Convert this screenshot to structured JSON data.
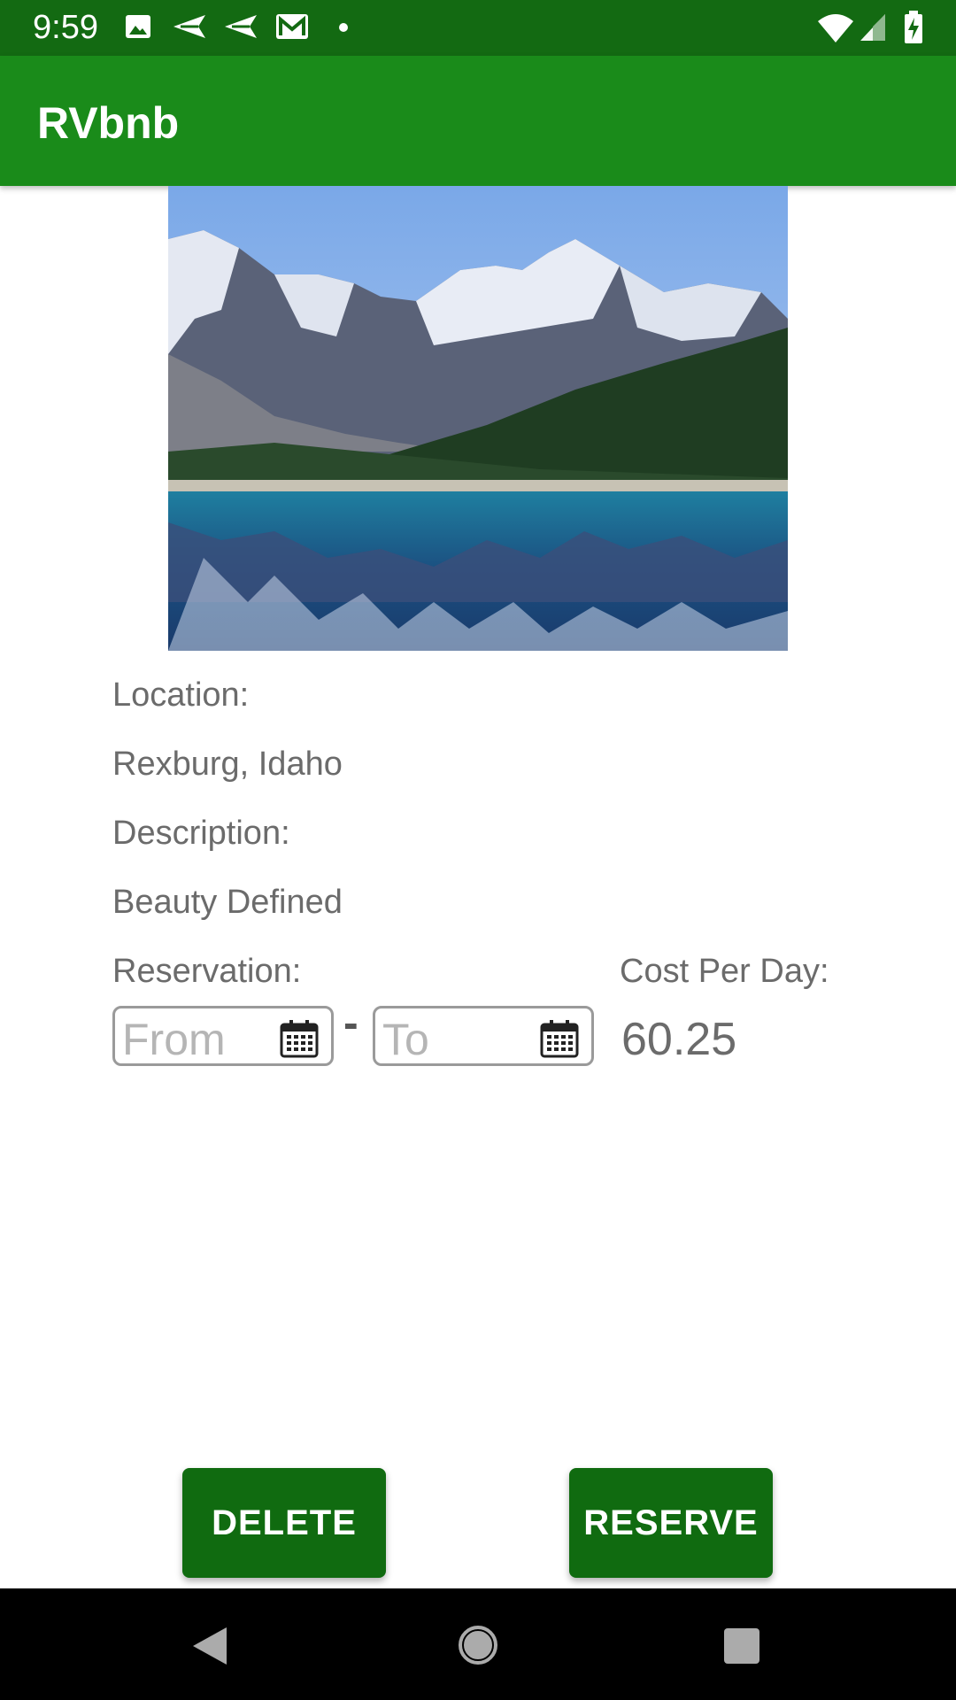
{
  "status_bar": {
    "time": "9:59",
    "left_icons": [
      "image-icon",
      "send-icon",
      "send-icon",
      "gmail-icon",
      "dot-icon"
    ],
    "right_icons": [
      "wifi-icon",
      "signal-icon",
      "battery-charging-icon"
    ]
  },
  "app_bar": {
    "title": "RVbnb"
  },
  "listing": {
    "location_label": "Location:",
    "location_value": "Rexburg, Idaho",
    "description_label": "Description:",
    "description_value": "Beauty Defined",
    "reservation_label": "Reservation:",
    "from_placeholder": "From",
    "range_separator": "-",
    "to_placeholder": "To",
    "cost_label": "Cost Per Day:",
    "cost_value": "60.25"
  },
  "actions": {
    "delete_label": "DELETE",
    "reserve_label": "RESERVE"
  },
  "nav_bar": {
    "icons": [
      "back-icon",
      "home-icon",
      "recents-icon"
    ]
  },
  "colors": {
    "status_bar": "#136a12",
    "app_bar": "#1a8b1a",
    "button": "#106b10",
    "text": "#6b6b6b"
  }
}
